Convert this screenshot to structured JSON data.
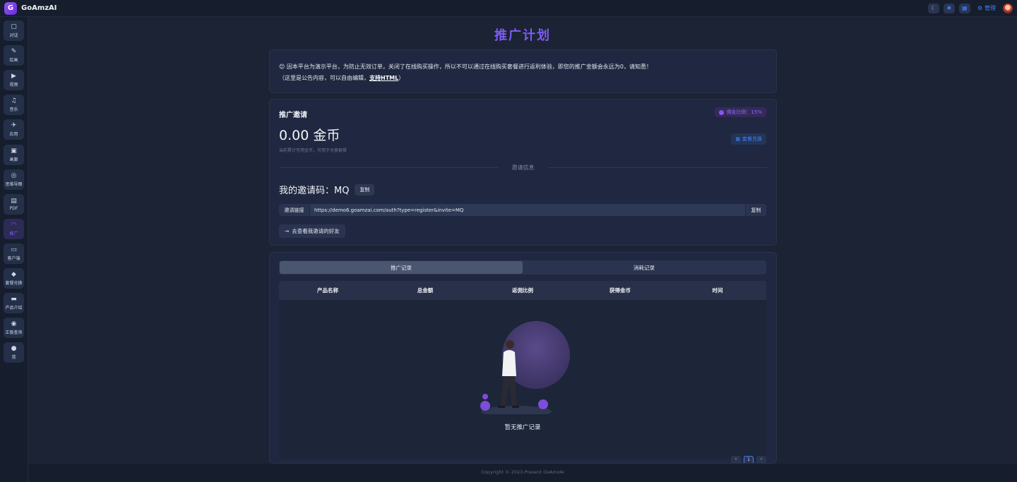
{
  "app": {
    "title": "GoAmzAI",
    "logo_text": "G"
  },
  "topbar": {
    "theme_icon": "☾",
    "mic_icon": "✱",
    "gift_icon": "▦",
    "manage_label": "管理"
  },
  "sidebar": {
    "items": [
      {
        "label": "对话",
        "icon": "▢",
        "name": "chat"
      },
      {
        "label": "绘画",
        "icon": "✎",
        "name": "draw"
      },
      {
        "label": "视频",
        "icon": "▶",
        "name": "video"
      },
      {
        "label": "音乐",
        "icon": "♫",
        "name": "music"
      },
      {
        "label": "应用",
        "icon": "✈",
        "name": "apps"
      },
      {
        "label": "画廊",
        "icon": "▣",
        "name": "gallery"
      },
      {
        "label": "思维导图",
        "icon": "◎",
        "name": "mindmap"
      },
      {
        "label": "PDF",
        "icon": "▤",
        "name": "pdf"
      },
      {
        "label": "推广",
        "icon": "◠",
        "name": "promote"
      },
      {
        "label": "客户端",
        "icon": "▭",
        "name": "client"
      },
      {
        "label": "套餐兑换",
        "icon": "◆",
        "name": "redeem"
      },
      {
        "label": "产品介绍",
        "icon": "▬",
        "name": "product"
      },
      {
        "label": "正版查询",
        "icon": "◉",
        "name": "verify"
      },
      {
        "label": "我",
        "icon": "●",
        "name": "me"
      }
    ]
  },
  "page": {
    "title": "推广计划"
  },
  "notice": {
    "emoji": "😊",
    "line1": "因本平台为演示平台，为防止无效订单，关闭了在线购买操作，所以不可以通过在线购买套餐进行返利体验，即您的推广金额会永远为0，请知悉！",
    "line2_pre": "（这里是公告内容，可以自由编辑，",
    "line2_bold": "支持HTML",
    "line2_post": "）"
  },
  "invite": {
    "title": "推广邀请",
    "ratio_label": "佣金比例：15%",
    "balance": "0.00 金币",
    "balance_hint": "当前累计可用金币，可用于兑换套餐",
    "redeem_label": "套餐兑换",
    "divider_label": "邀请信息",
    "code_line": "我的邀请码：MQ",
    "copy_label": "复制",
    "link_label": "邀请链接",
    "link_url": "https://demo6.goamzai.com/auth?type=register&invite=MQ",
    "link_copy_label": "复制",
    "friends_label": "去查看我邀请的好友"
  },
  "records": {
    "tabs": [
      {
        "label": "推广记录",
        "active": true
      },
      {
        "label": "消耗记录",
        "active": false
      }
    ],
    "columns": [
      "产品名称",
      "总金额",
      "返佣比例",
      "获得金币",
      "时间"
    ],
    "empty_text": "暂无推广记录",
    "pager": {
      "prev": "‹",
      "current": "1",
      "next": "›"
    }
  },
  "footer": {
    "text": "Copyright © 2023-Present GoAmzAI"
  },
  "colors": {
    "accent": "#8b5cf6",
    "link": "#3b82f6",
    "bg": "#1b2335",
    "card": "#1f2840"
  }
}
